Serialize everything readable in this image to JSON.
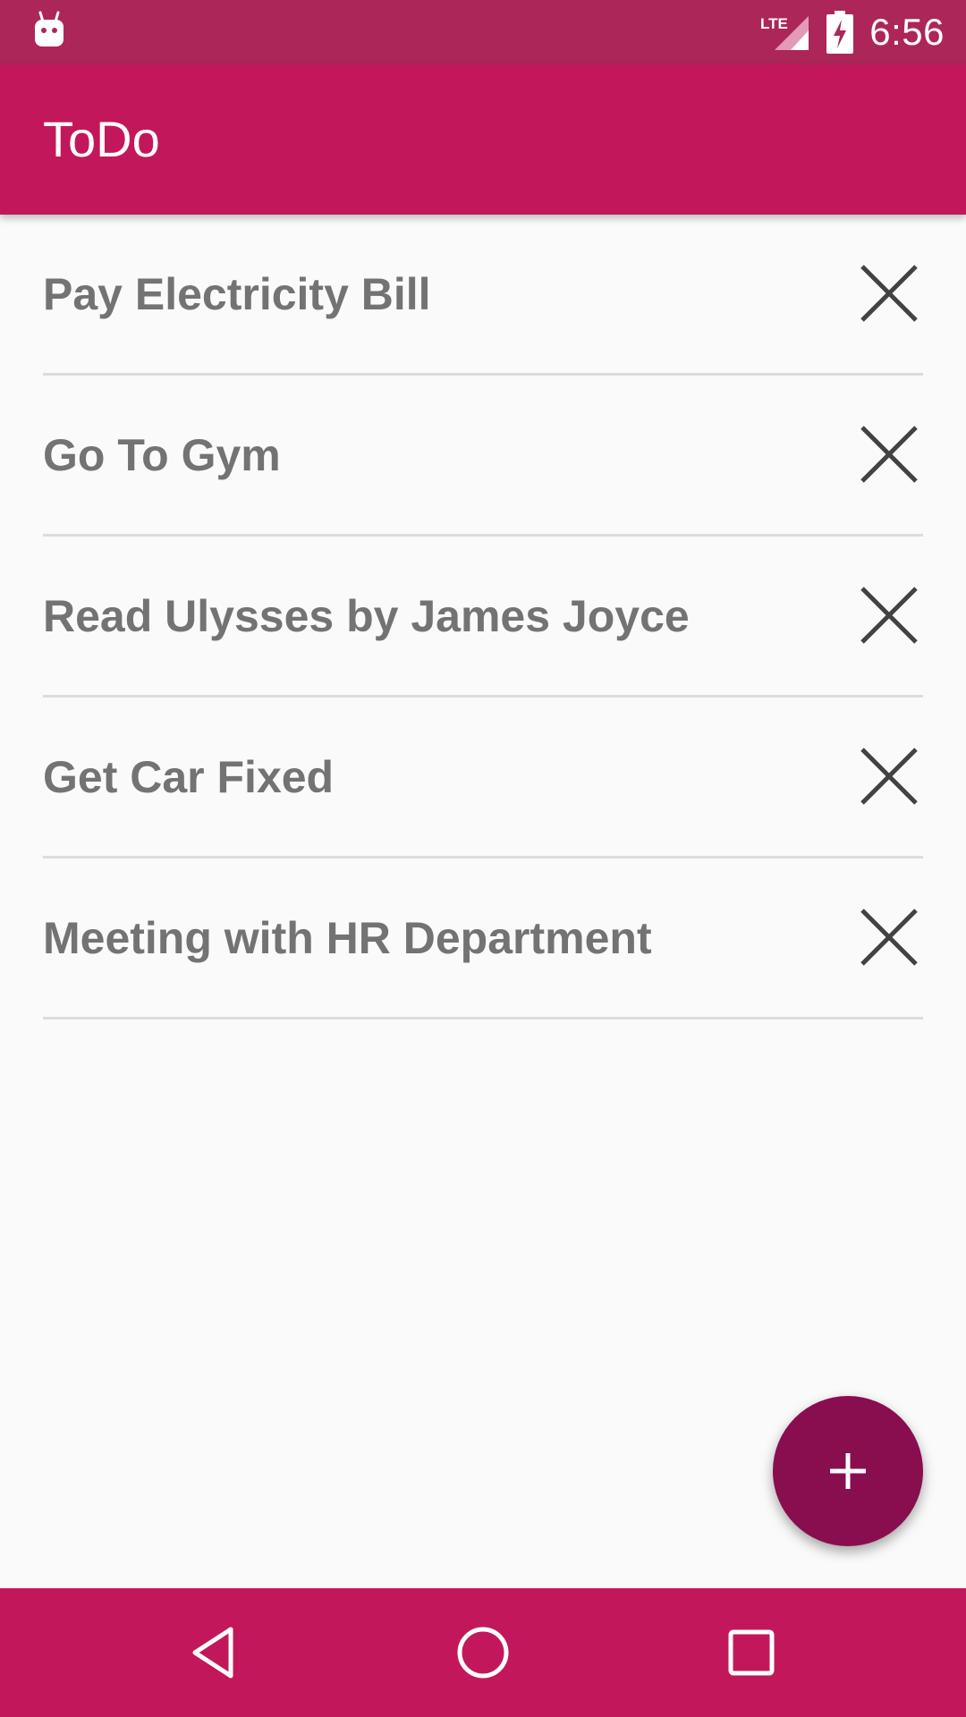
{
  "status_bar": {
    "time": "6:56",
    "network_label": "LTE",
    "icons": [
      "android-notification-icon",
      "lte-signal-icon",
      "battery-charging-icon"
    ]
  },
  "app_bar": {
    "title": "ToDo"
  },
  "todos": [
    {
      "text": "Pay Electricity Bill"
    },
    {
      "text": "Go To Gym"
    },
    {
      "text": "Read Ulysses by James Joyce"
    },
    {
      "text": "Get Car Fixed"
    },
    {
      "text": "Meeting with HR Department"
    }
  ],
  "fab": {
    "icon": "plus-icon"
  },
  "nav_bar": {
    "icons": [
      "back-icon",
      "home-icon",
      "recent-apps-icon"
    ]
  },
  "colors": {
    "status_bar": "#ac2659",
    "primary": "#c2185b",
    "accent": "#880e4f",
    "background": "#fafafa",
    "item_text": "#737373",
    "divider": "#dcdcdc"
  }
}
